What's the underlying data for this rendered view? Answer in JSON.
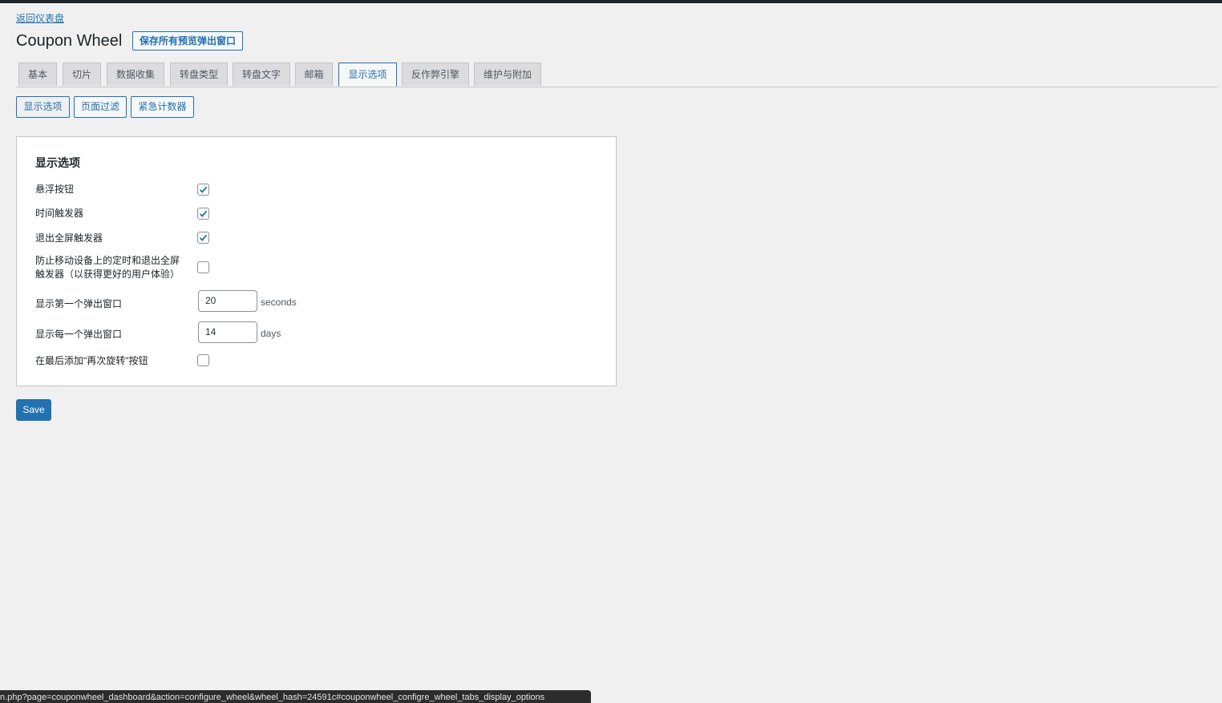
{
  "header": {
    "back_link": "返回仪表盘",
    "title": "Coupon Wheel",
    "preview_button": "保存所有预览弹出窗口"
  },
  "tabs": [
    {
      "label": "基本",
      "active": false
    },
    {
      "label": "切片",
      "active": false
    },
    {
      "label": "数据收集",
      "active": false
    },
    {
      "label": "转盘类型",
      "active": false
    },
    {
      "label": "转盘文字",
      "active": false
    },
    {
      "label": "邮箱",
      "active": false
    },
    {
      "label": "显示选项",
      "active": true
    },
    {
      "label": "反作弊引擎",
      "active": false
    },
    {
      "label": "维护与附加",
      "active": false
    }
  ],
  "subtabs": [
    {
      "label": "显示选项",
      "active": true
    },
    {
      "label": "页面过滤",
      "active": false
    },
    {
      "label": "紧急计数器",
      "active": false
    }
  ],
  "panel": {
    "title": "显示选项",
    "options": {
      "floating_button": {
        "label": "悬浮按钮",
        "checked": true
      },
      "time_trigger": {
        "label": "时间触发器",
        "checked": true
      },
      "exit_fullscreen_trigger": {
        "label": "退出全屏触发器",
        "checked": true
      },
      "prevent_mobile": {
        "label": "防止移动设备上的定时和退出全屏触发器（以获得更好的用户体验）",
        "checked": false
      },
      "first_popup": {
        "label": "显示第一个弹出窗口",
        "value": "20",
        "unit": "seconds"
      },
      "every_popup": {
        "label": "显示每一个弹出窗口",
        "value": "14",
        "unit": "days"
      },
      "spin_again": {
        "label": "在最后添加\"再次旋转\"按钮",
        "checked": false
      }
    }
  },
  "save_button": "Save",
  "status_url": "n.php?page=couponwheel_dashboard&action=configure_wheel&wheel_hash=24591c#couponwheel_configre_wheel_tabs_display_options",
  "colors": {
    "accent": "#2271b1",
    "background": "#f0f0f1",
    "panel": "#ffffff"
  }
}
